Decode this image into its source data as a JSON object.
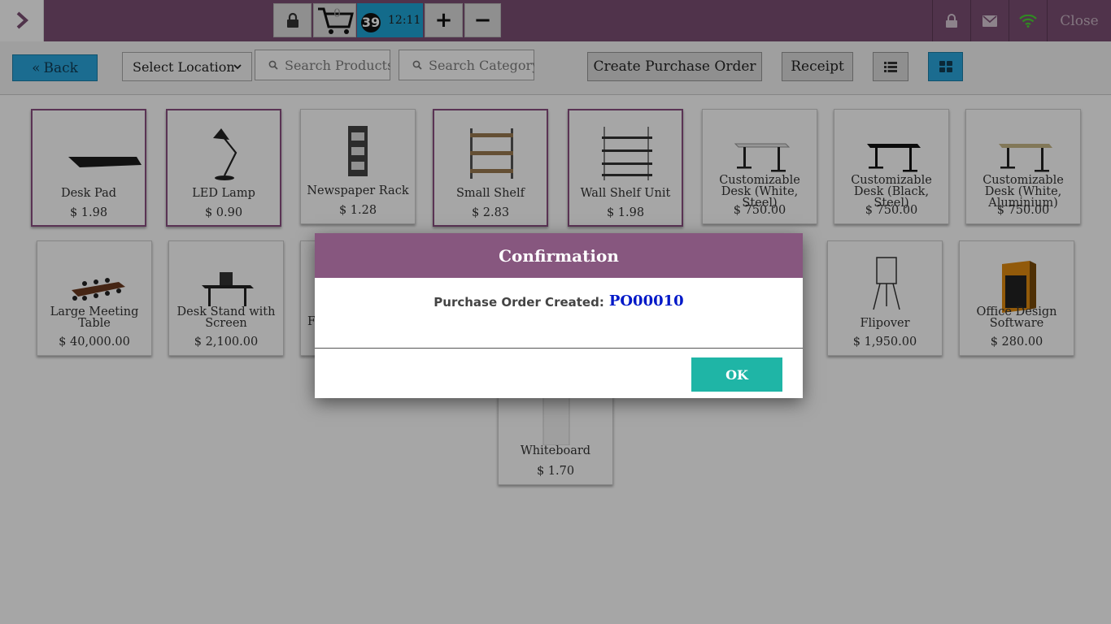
{
  "topbar": {
    "cart_count": "0",
    "order_badge": "39",
    "order_time": "12:11",
    "plus_label": "+",
    "minus_label": "−",
    "close_label": "Close",
    "colors": {
      "bar": "#7b4f73",
      "order_tab": "#1ea5d6",
      "wifi": "#4cd137"
    },
    "icons": [
      "chevron-right-icon",
      "lock-icon",
      "cart-icon",
      "lock-icon",
      "mail-icon",
      "wifi-icon"
    ]
  },
  "controls": {
    "back_label": "Back",
    "location_select": "Select Location",
    "search_products_placeholder": "Search Products",
    "search_category_placeholder": "Search Category",
    "create_po_label": "Create Purchase Order",
    "receipt_label": "Receipt",
    "view_mode": "grid"
  },
  "products": [
    {
      "name": "Desk Pad",
      "price": "$ 1.98",
      "selected": true,
      "icon": "desk-pad-icon"
    },
    {
      "name": "LED Lamp",
      "price": "$ 0.90",
      "selected": true,
      "icon": "lamp-icon"
    },
    {
      "name": "Newspaper Rack",
      "price": "$ 1.28",
      "selected": false,
      "icon": "rack-icon"
    },
    {
      "name": "Small Shelf",
      "price": "$ 2.83",
      "selected": true,
      "icon": "shelf-icon"
    },
    {
      "name": "Wall Shelf Unit",
      "price": "$ 1.98",
      "selected": true,
      "icon": "wall-shelf-icon"
    },
    {
      "name": "Customizable Desk (White, Steel)",
      "price": "$ 750.00",
      "selected": false,
      "icon": "desk-icon"
    },
    {
      "name": "Customizable Desk (Black, Steel)",
      "price": "$ 750.00",
      "selected": false,
      "icon": "desk-icon"
    },
    {
      "name": "Customizable Desk (White, Aluminium)",
      "price": "$ 750.00",
      "selected": false,
      "icon": "desk-icon"
    },
    {
      "name": "Large Meeting Table",
      "price": "$ 40,000.00",
      "selected": false,
      "icon": "meeting-table-icon"
    },
    {
      "name": "Desk Stand with Screen",
      "price": "$ 2,100.00",
      "selected": false,
      "icon": "desk-stand-icon"
    },
    {
      "name": "F",
      "price": "",
      "selected": false,
      "icon": ""
    },
    {
      "name": "Flipover",
      "price": "$ 1,950.00",
      "selected": false,
      "icon": "flipover-icon"
    },
    {
      "name": "Office Design Software",
      "price": "$ 280.00",
      "selected": false,
      "icon": "software-box-icon"
    },
    {
      "name": "Whiteboard",
      "price": "$ 1.70",
      "selected": false,
      "icon": "whiteboard-icon"
    }
  ],
  "modal": {
    "title": "Confirmation",
    "label": "Purchase Order Created:",
    "po_number": "PO00010",
    "ok_label": "OK",
    "colors": {
      "header": "#87577f",
      "po_text": "#0018c8",
      "ok": "#1fb5a6"
    }
  }
}
